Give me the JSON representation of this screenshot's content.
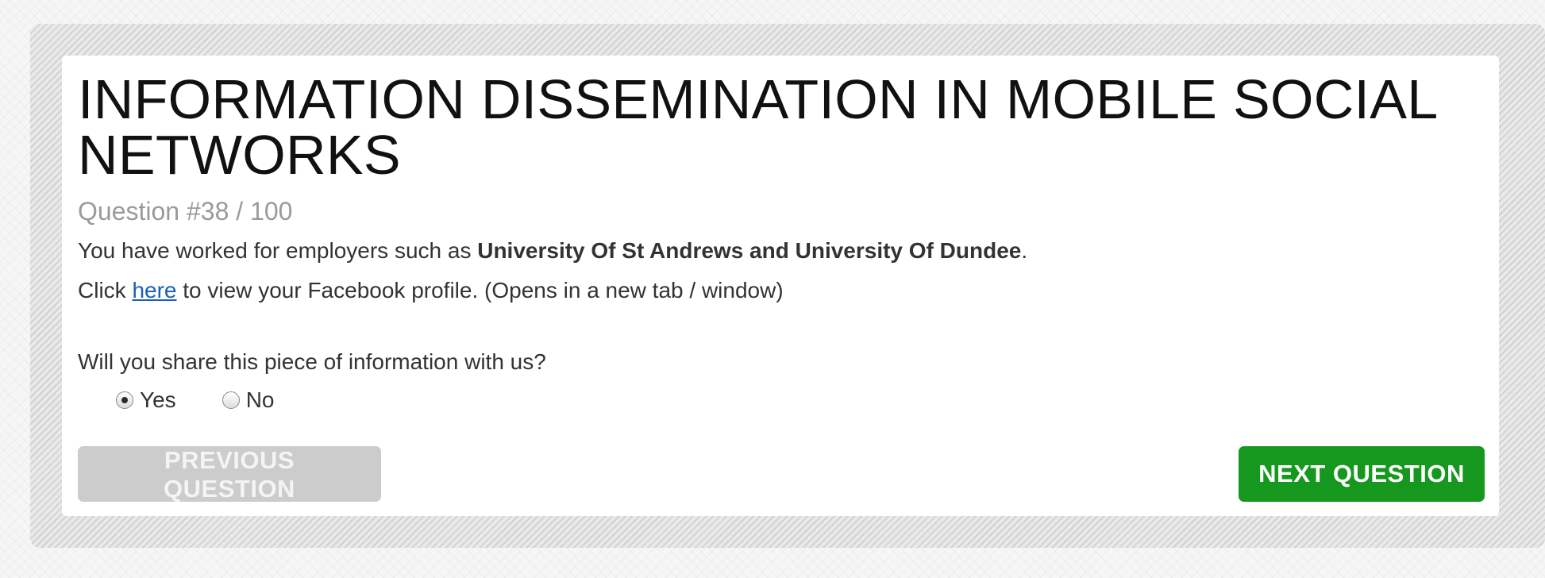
{
  "header": {
    "title": "INFORMATION DISSEMINATION IN MOBILE SOCIAL NETWORKS",
    "question_number": "Question #38 / 100"
  },
  "statement": {
    "prefix": "You have worked for employers such as ",
    "employers": "University Of St Andrews and University Of Dundee",
    "suffix": "."
  },
  "profile_line": {
    "prefix": "Click ",
    "link_text": "here",
    "suffix": " to view your Facebook profile. (Opens in a new tab / window)"
  },
  "question": {
    "text": "Will you share this piece of information with us?",
    "options": [
      {
        "label": "Yes",
        "selected": true
      },
      {
        "label": "No",
        "selected": false
      }
    ]
  },
  "navigation": {
    "previous_label": "PREVIOUS QUESTION",
    "previous_enabled": false,
    "next_label": "NEXT QUESTION"
  },
  "colors": {
    "next_button": "#16981f",
    "previous_button_disabled": "#cccccc",
    "link": "#1b5fb8"
  }
}
